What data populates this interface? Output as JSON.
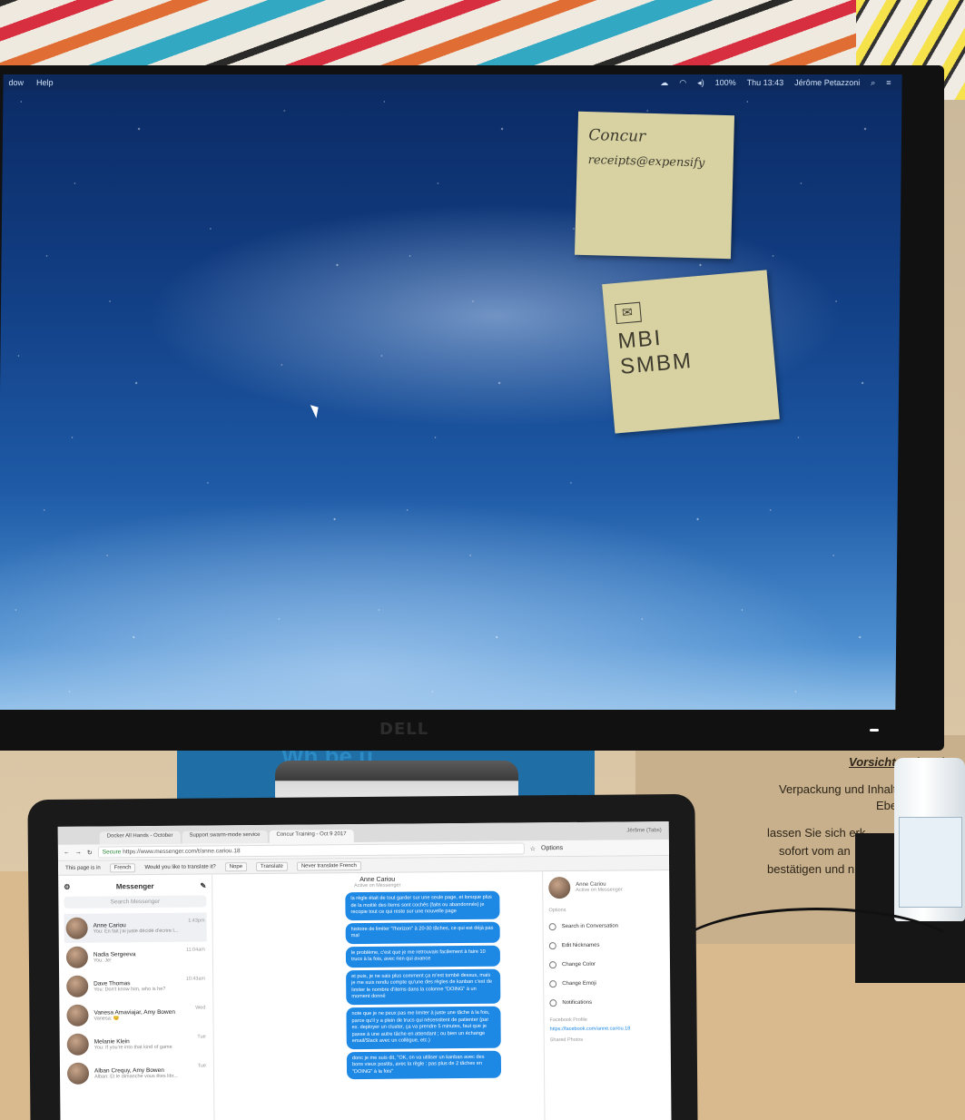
{
  "desktop": {
    "menubar": {
      "left_items": [
        "dow",
        "Help"
      ],
      "clock": "Thu 13:43",
      "user": "Jérôme Petazzoni",
      "battery": "100%"
    },
    "postit_1": {
      "lines": [
        "Concur",
        "receipts@expensify"
      ]
    },
    "postit_2": {
      "lines": [
        "MBI",
        "SMBM"
      ]
    },
    "monitor_brand": "DELL"
  },
  "scene": {
    "box_text": [
      "Vorsicht zerbrech",
      "Verpackung und Inhalt so",
      "Eben",
      "lassen Sie sich erk",
      "sofort vom an",
      "bestätigen und n"
    ],
    "stand_text": "Wh  be  u"
  },
  "browser": {
    "user_tag": "Jérôme (Tabs)",
    "tabs": [
      {
        "label": "Docker All Hands - October"
      },
      {
        "label": "Support swarm-mode service"
      },
      {
        "label": "Concur Training - Oct 9 2017"
      }
    ],
    "secure_label": "Secure",
    "url": "https://www.messenger.com/t/anne.cariou.18",
    "options_label": "Options",
    "translate_bar": {
      "prefix": "This page is in",
      "language": "French",
      "question": "Would you like to translate it?",
      "nope": "Nope",
      "translate": "Translate",
      "never": "Never translate French"
    }
  },
  "messenger": {
    "title": "Messenger",
    "search_placeholder": "Search Messenger",
    "conversations": [
      {
        "name": "Anne Cariou",
        "preview": "You: En fait j'ai juste décidé d'écrire l...",
        "time": "1:43pm"
      },
      {
        "name": "Nadia Sergeeva",
        "preview": "You: Je!",
        "time": "11:04am"
      },
      {
        "name": "Dave Thomas",
        "preview": "You: Don't know him, who is he?",
        "time": "10:43am"
      },
      {
        "name": "Vanesa Amaviajar, Amy Bowen",
        "preview": "Vanesa: 😊",
        "time": "Wed"
      },
      {
        "name": "Melanie Klein",
        "preview": "You: If you're into that kind of game",
        "time": "Tue"
      },
      {
        "name": "Alban Crequy, Amy Bowen",
        "preview": "Alban: Et le dimanche vous êtes libr...",
        "time": "Tue"
      }
    ],
    "chat": {
      "name": "Anne Cariou",
      "status": "Active on Messenger",
      "messages": [
        "la règle était de tout garder sur une seule page, et lorsque plus de la moitié des items sont cochés (faits ou abandonnés) je recopie tout ce qui reste sur une nouvelle page",
        "histoire de limiter \"l'horizon\" à 20-30 tâches, ce qui est déjà pas mal",
        "le problème, c'est que je me retrouvais facilement à faire 10 trucs à la fois, avec rien qui avance",
        "et puis, je ne sais plus comment ça m'est tombé dessus, mais je me suis rendu compte qu'une des règles de kanban c'est de limiter le nombre d'items dans la colonne \"DOING\" à un moment donné",
        "note que je ne peux pas me limiter à juste une tâche à la fois, parce qu'il y a plein de trucs qui nécessitent de patienter (par ex. deployer un cluster, ça va prendre 5 minutes, faut que je passe à une autre tâche en attendant ; ou bien un échange email/Slack avec un collègue, etc.)",
        "donc je me suis dit, \"OK, on va utiliser un kanban avec des bons vieux postits, avec la règle : pas plus de 2 tâches en \"DOING\" à la fois\""
      ]
    },
    "details": {
      "name": "Anne Cariou",
      "status": "Active on Messenger",
      "options_title": "Options",
      "options": [
        "Search in Conversation",
        "Edit Nicknames",
        "Change Color",
        "Change Emoji",
        "Notifications"
      ],
      "profile_title": "Facebook Profile",
      "profile_link": "https://facebook.com/anne.cariou.18",
      "shared_photos": "Shared Photos"
    }
  },
  "colors": {
    "bubble": "#1e88e5",
    "sky_top": "#0b2a63",
    "sky_bottom": "#8fbfe8",
    "postit": "#d8d2a2"
  }
}
